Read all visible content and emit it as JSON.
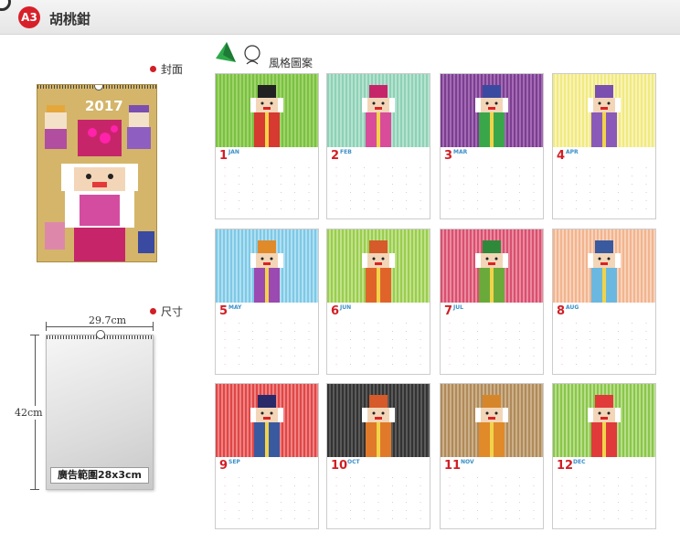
{
  "header": {
    "badge": "A3",
    "title": "胡桃鉗"
  },
  "labels": {
    "cover": "封面",
    "size": "尺寸",
    "style": "風格圖案"
  },
  "cover": {
    "year": "2017"
  },
  "size": {
    "width": "29.7cm",
    "height": "42cm",
    "ad_area": "廣告範圍28x3cm"
  },
  "colors": {
    "accent_red": "#d21e25",
    "month_blue": "#3a8fc7",
    "badge_red": "#d8202a"
  },
  "months": [
    {
      "num": "1",
      "name": "JAN"
    },
    {
      "num": "2",
      "name": "FEB"
    },
    {
      "num": "3",
      "name": "MAR"
    },
    {
      "num": "4",
      "name": "APR"
    },
    {
      "num": "5",
      "name": "MAY"
    },
    {
      "num": "6",
      "name": "JUN"
    },
    {
      "num": "7",
      "name": "JUL"
    },
    {
      "num": "8",
      "name": "AUG"
    },
    {
      "num": "9",
      "name": "SEP"
    },
    {
      "num": "10",
      "name": "OCT"
    },
    {
      "num": "11",
      "name": "NOV"
    },
    {
      "num": "12",
      "name": "DEC"
    }
  ]
}
